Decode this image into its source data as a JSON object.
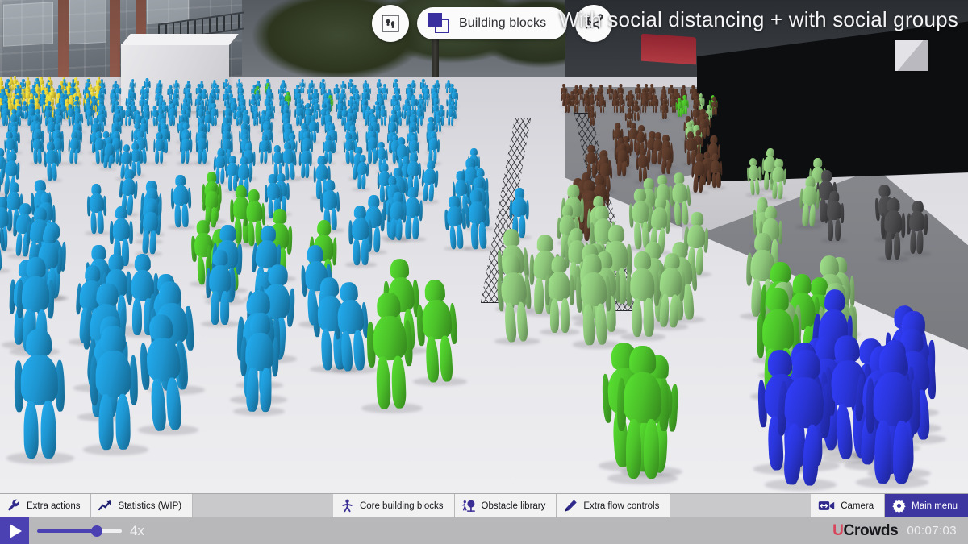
{
  "app": {
    "name": "UCrowds",
    "logo_u": "U",
    "logo_rest": "Crowds"
  },
  "scene": {
    "title": "With social distancing + with social groups",
    "description": "3D crowd simulation viewport with humanoid agents, mesh barriers and building obstacles"
  },
  "top_toolbar": {
    "buttons": [
      {
        "name": "footprints-mode",
        "icon": "footprints-icon",
        "label": ""
      },
      {
        "name": "building-blocks",
        "icon": "building-blocks-icon",
        "label": "Building blocks"
      },
      {
        "name": "routing-mode",
        "icon": "walking-route-icon",
        "label": ""
      }
    ]
  },
  "bottom_toolbar": {
    "left_buttons": [
      {
        "name": "extra-actions",
        "label": "Extra actions",
        "icon": "wrench-icon",
        "accent": false
      },
      {
        "name": "statistics",
        "label": "Statistics (WIP)",
        "icon": "trending-up-icon",
        "accent": false
      }
    ],
    "center_buttons": [
      {
        "name": "core-building-blocks",
        "label": "Core building blocks",
        "icon": "person-icon",
        "accent": false
      },
      {
        "name": "obstacle-library",
        "label": "Obstacle library",
        "icon": "person-tree-icon",
        "accent": false
      },
      {
        "name": "extra-flow-controls",
        "label": "Extra flow controls",
        "icon": "pencil-icon",
        "accent": false
      }
    ],
    "right_buttons": [
      {
        "name": "camera",
        "label": "Camera",
        "icon": "video-camera-icon",
        "accent": false
      },
      {
        "name": "main-menu",
        "label": "Main menu",
        "icon": "gear-icon",
        "accent": true
      }
    ]
  },
  "transport": {
    "play_label": "play",
    "speed_value": "4x",
    "speed_percent": 70,
    "elapsed_time": "00:07:03"
  },
  "colors": {
    "accent_purple": "#3d35a0",
    "slider_purple": "#4b41b3",
    "logo_red": "#d8455c",
    "agent_cyan": "#1e95d0",
    "agent_green": "#4cc22a",
    "agent_light_green": "#8cc479",
    "agent_blue": "#2a35d8",
    "agent_brown": "#5a3a2a",
    "agent_grey": "#4a4a4c",
    "agent_yellow": "#e8d23a",
    "toolbar_bg": "#c9c9cb",
    "transport_bg": "#b8b8ba"
  },
  "agent_groups": [
    {
      "name": "cyan-crowd-left",
      "color": "#1e95d0",
      "count": 120
    },
    {
      "name": "green-crowd-center",
      "color": "#4cc22a",
      "count": 22
    },
    {
      "name": "light-green-crowd-right",
      "color": "#8cc479",
      "count": 38
    },
    {
      "name": "brown-queue",
      "color": "#5a3a2a",
      "count": 46
    },
    {
      "name": "grey-group",
      "color": "#4a4a4c",
      "count": 5
    },
    {
      "name": "blue-cluster-bottom-right",
      "color": "#2a35d8",
      "count": 16
    },
    {
      "name": "yellow-crowd-far-left",
      "color": "#e8d23a",
      "count": 40
    }
  ]
}
